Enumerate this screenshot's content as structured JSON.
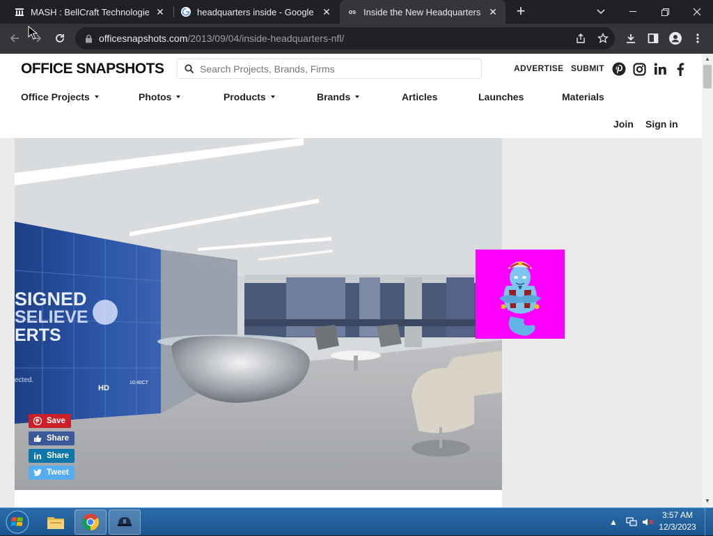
{
  "browser": {
    "tabs": [
      {
        "title": "MASH : BellCraft Technologies : Ir",
        "favicon": "grid-favicon-icon",
        "active": false
      },
      {
        "title": "headquarters inside - Google Se",
        "favicon": "google-icon",
        "active": false
      },
      {
        "title": "Inside the New Headquarters of",
        "favicon": "os",
        "active": true
      }
    ],
    "url_host": "officesnapshots.com",
    "url_path": "/2013/09/04/inside-headquarters-nfl/"
  },
  "site": {
    "logo": "OFFICE SNAPSHOTS",
    "search_placeholder": "Search Projects, Brands, Firms",
    "top_links": [
      "ADVERTISE",
      "SUBMIT"
    ],
    "social_icons": [
      "pinterest-icon",
      "instagram-icon",
      "linkedin-icon",
      "facebook-icon"
    ],
    "nav": [
      {
        "label": "Office Projects",
        "dropdown": true
      },
      {
        "label": "Photos",
        "dropdown": true
      },
      {
        "label": "Products",
        "dropdown": true
      },
      {
        "label": "Brands",
        "dropdown": true
      },
      {
        "label": "Articles",
        "dropdown": false
      },
      {
        "label": "Launches",
        "dropdown": false
      },
      {
        "label": "Materials",
        "dropdown": false
      }
    ],
    "account": {
      "join": "Join",
      "signin": "Sign in"
    }
  },
  "hero": {
    "screen_text_lines": [
      "SIGNED",
      "SELIEVE",
      "ERTS"
    ],
    "screen_small_text": "ected.",
    "screen_logo": "HD",
    "screen_time": "10:40CT"
  },
  "share_buttons": [
    {
      "label": "Save",
      "color": "#cb2027",
      "icon": "pinterest-icon"
    },
    {
      "label": "Share",
      "color": "#3b5998",
      "icon": "thumbs-up-icon"
    },
    {
      "label": "Share",
      "color": "#0e76a8",
      "icon": "linkedin-icon"
    },
    {
      "label": "Tweet",
      "color": "#55acee",
      "icon": "twitter-icon"
    }
  ],
  "taskbar": {
    "time": "3:57 AM",
    "date": "12/3/2023"
  },
  "colors": {
    "chrome_dark": "#202124",
    "chrome_toolbar": "#35363a",
    "genie_bg": "#ff00ff"
  }
}
